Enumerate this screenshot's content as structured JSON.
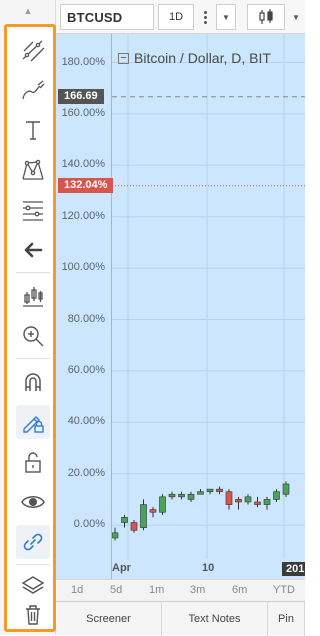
{
  "toolbar": {
    "collapse_icon": "chevron-up-icon",
    "tools": [
      {
        "id": "trend-line",
        "icon": "trend-line-icon"
      },
      {
        "id": "brush",
        "icon": "brush-icon"
      },
      {
        "id": "text",
        "icon": "text-icon"
      },
      {
        "id": "pattern",
        "icon": "pattern-icon"
      },
      {
        "id": "fib",
        "icon": "fib-retracement-icon"
      },
      {
        "id": "remove",
        "icon": "arrow-left-icon"
      },
      {
        "id": "measure",
        "icon": "measure-icon"
      },
      {
        "id": "zoom",
        "icon": "zoom-in-icon"
      },
      {
        "id": "magnet",
        "icon": "magnet-icon"
      },
      {
        "id": "lock-drawings",
        "icon": "pencil-lock-icon"
      },
      {
        "id": "lock-all",
        "icon": "unlock-icon"
      },
      {
        "id": "hide",
        "icon": "eye-icon"
      },
      {
        "id": "sync",
        "icon": "link-icon"
      },
      {
        "id": "object-tree",
        "icon": "layers-icon"
      },
      {
        "id": "delete",
        "icon": "trash-icon"
      }
    ],
    "accent": "#f39a27"
  },
  "topbar": {
    "symbol": "BTCUSD",
    "interval": "1D"
  },
  "chart": {
    "legend": "Bitcoin / Dollar, D, BIT",
    "price_flags": [
      {
        "label": "166.69",
        "color": "#555555",
        "value": 166.69
      },
      {
        "label": "132.04%",
        "color": "#d9534f",
        "value": 132.04
      }
    ],
    "time_labels": [
      {
        "label": "Apr"
      },
      {
        "label": "10"
      },
      {
        "label": "201",
        "badge": true
      }
    ]
  },
  "chart_data": {
    "type": "candlestick",
    "title": "Bitcoin / Dollar, D, BIT",
    "ylim": [
      -22,
      190
    ],
    "y_ticks": [
      "180.00%",
      "160.00%",
      "140.00%",
      "120.00%",
      "100.00%",
      "80.00%",
      "60.00%",
      "40.00%",
      "20.00%",
      "0.00%"
    ],
    "x_ticks": [
      "Apr",
      "10",
      "201"
    ],
    "grid": true,
    "candles": [
      {
        "open": -5,
        "close": -3,
        "high": -1,
        "low": -6
      },
      {
        "open": 1,
        "close": 3,
        "high": 4,
        "low": -1
      },
      {
        "open": 1,
        "close": -2,
        "high": 2,
        "low": -3
      },
      {
        "open": -1,
        "close": 8,
        "high": 10,
        "low": -2
      },
      {
        "open": 6,
        "close": 5,
        "high": 7,
        "low": 3
      },
      {
        "open": 5,
        "close": 11,
        "high": 12,
        "low": 4
      },
      {
        "open": 11,
        "close": 12,
        "high": 13,
        "low": 10
      },
      {
        "open": 11,
        "close": 12,
        "high": 13,
        "low": 10
      },
      {
        "open": 10,
        "close": 12,
        "high": 13,
        "low": 9
      },
      {
        "open": 12,
        "close": 13,
        "high": 14,
        "low": 12
      },
      {
        "open": 13,
        "close": 14,
        "high": 14,
        "low": 12
      },
      {
        "open": 14,
        "close": 13,
        "high": 15,
        "low": 12
      },
      {
        "open": 13,
        "close": 8,
        "high": 14,
        "low": 6
      },
      {
        "open": 10,
        "close": 9,
        "high": 11,
        "low": 6
      },
      {
        "open": 9,
        "close": 11,
        "high": 12,
        "low": 8
      },
      {
        "open": 9,
        "close": 8,
        "high": 11,
        "low": 7
      },
      {
        "open": 8,
        "close": 10,
        "high": 11,
        "low": 6
      },
      {
        "open": 10,
        "close": 13,
        "high": 14,
        "low": 9
      },
      {
        "open": 12,
        "close": 16,
        "high": 17,
        "low": 11
      }
    ],
    "up_color": "#4aa35a",
    "down_color": "#d9534f",
    "horizontal_lines": [
      {
        "value": 166.69,
        "style": "dashed",
        "color": "#8a8a8a"
      },
      {
        "value": 132.04,
        "style": "dotted",
        "color": "#d9534f"
      }
    ]
  },
  "range_bar": [
    "1d",
    "5d",
    "1m",
    "3m",
    "6m",
    "YTD"
  ],
  "bottom_tabs": [
    "Screener",
    "Text Notes",
    "Pin"
  ]
}
